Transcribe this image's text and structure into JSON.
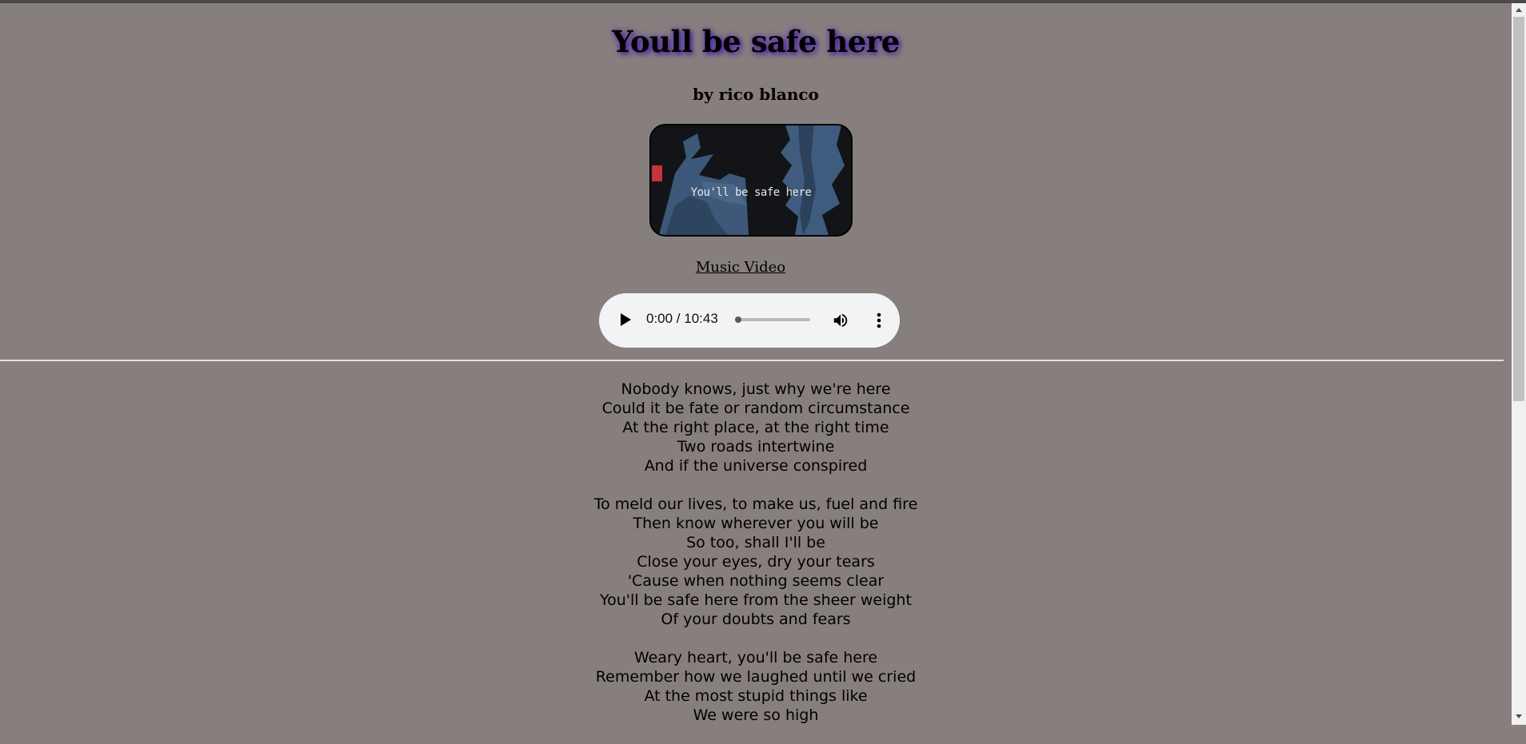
{
  "page": {
    "title": "Youll be safe here",
    "byline": "by rico blanco",
    "thumbnail": {
      "caption": "You'll be safe here"
    },
    "video_link": "Music Video"
  },
  "audio_player": {
    "time": "0:00 / 10:43",
    "progress": 0,
    "icons": {
      "play": "play-icon",
      "volume": "volume-icon",
      "more": "more-vertical-icon"
    }
  },
  "lyrics": {
    "stanzas": [
      [
        "Nobody knows, just why we're here",
        "Could it be fate or random circumstance",
        "At the right place, at the right time",
        "Two roads intertwine",
        "And if the universe conspired"
      ],
      [
        "To meld our lives, to make us, fuel and fire",
        "Then know wherever you will be",
        "So too, shall I'll be",
        "Close your eyes, dry your tears",
        "'Cause when nothing seems clear",
        "You'll be safe here from the sheer weight",
        "Of your doubts and fears"
      ],
      [
        "Weary heart, you'll be safe here",
        "Remember how we laughed until we cried",
        "At the most stupid things like",
        "We were so high"
      ]
    ]
  },
  "colors": {
    "background": "#877f7e",
    "title_glow": "#4b2e9a",
    "player_bg": "#f1f3f4",
    "rule": "#e2e2e2"
  }
}
